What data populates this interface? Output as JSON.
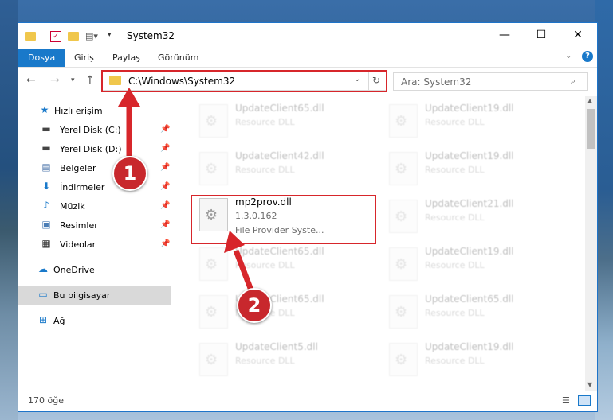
{
  "window": {
    "title": "System32",
    "min_icon": "minimize-icon",
    "max_icon": "maximize-icon",
    "close_icon": "close-icon"
  },
  "ribbon": {
    "tabs": [
      "Dosya",
      "Giriş",
      "Paylaş",
      "Görünüm"
    ]
  },
  "address": {
    "path": "C:\\Windows\\System32",
    "search_placeholder": "Ara: System32"
  },
  "sidebar": {
    "quick_access": "Hızlı erişim",
    "items": [
      {
        "label": "Yerel Disk (C:)",
        "icon": "drive-icon"
      },
      {
        "label": "Yerel Disk (D:)",
        "icon": "drive-icon"
      },
      {
        "label": "Belgeler",
        "icon": "documents-icon"
      },
      {
        "label": "İndirmeler",
        "icon": "download-icon"
      },
      {
        "label": "Müzik",
        "icon": "music-icon"
      },
      {
        "label": "Resimler",
        "icon": "pictures-icon"
      },
      {
        "label": "Videolar",
        "icon": "videos-icon"
      }
    ],
    "onedrive": "OneDrive",
    "this_pc": "Bu bilgisayar",
    "network": "Ağ"
  },
  "files": [
    {
      "name": "UpdateClient65.dll",
      "desc": "Resource DLL"
    },
    {
      "name": "UpdateClient19.dll",
      "desc": "Resource DLL"
    },
    {
      "name": "UpdateClient42.dll",
      "desc": "Resource DLL"
    },
    {
      "name": "UpdateClient19.dll",
      "desc": "Resource DLL"
    },
    {
      "name": "mp2prov.dll",
      "version": "1.3.0.162",
      "desc": "File Provider Syste..."
    },
    {
      "name": "UpdateClient21.dll",
      "desc": "Resource DLL"
    },
    {
      "name": "UpdateClient65.dll",
      "desc": "Resource DLL"
    },
    {
      "name": "UpdateClient19.dll",
      "desc": "Resource DLL"
    },
    {
      "name": "UpdateClient65.dll",
      "desc": "Resource DLL"
    },
    {
      "name": "UpdateClient65.dll",
      "desc": "Resource DLL"
    },
    {
      "name": "UpdateClient5.dll",
      "desc": "Resource DLL"
    },
    {
      "name": "UpdateClient19.dll",
      "desc": "Resource DLL"
    }
  ],
  "status": {
    "count": "170 öğe"
  },
  "markers": [
    "1",
    "2"
  ]
}
